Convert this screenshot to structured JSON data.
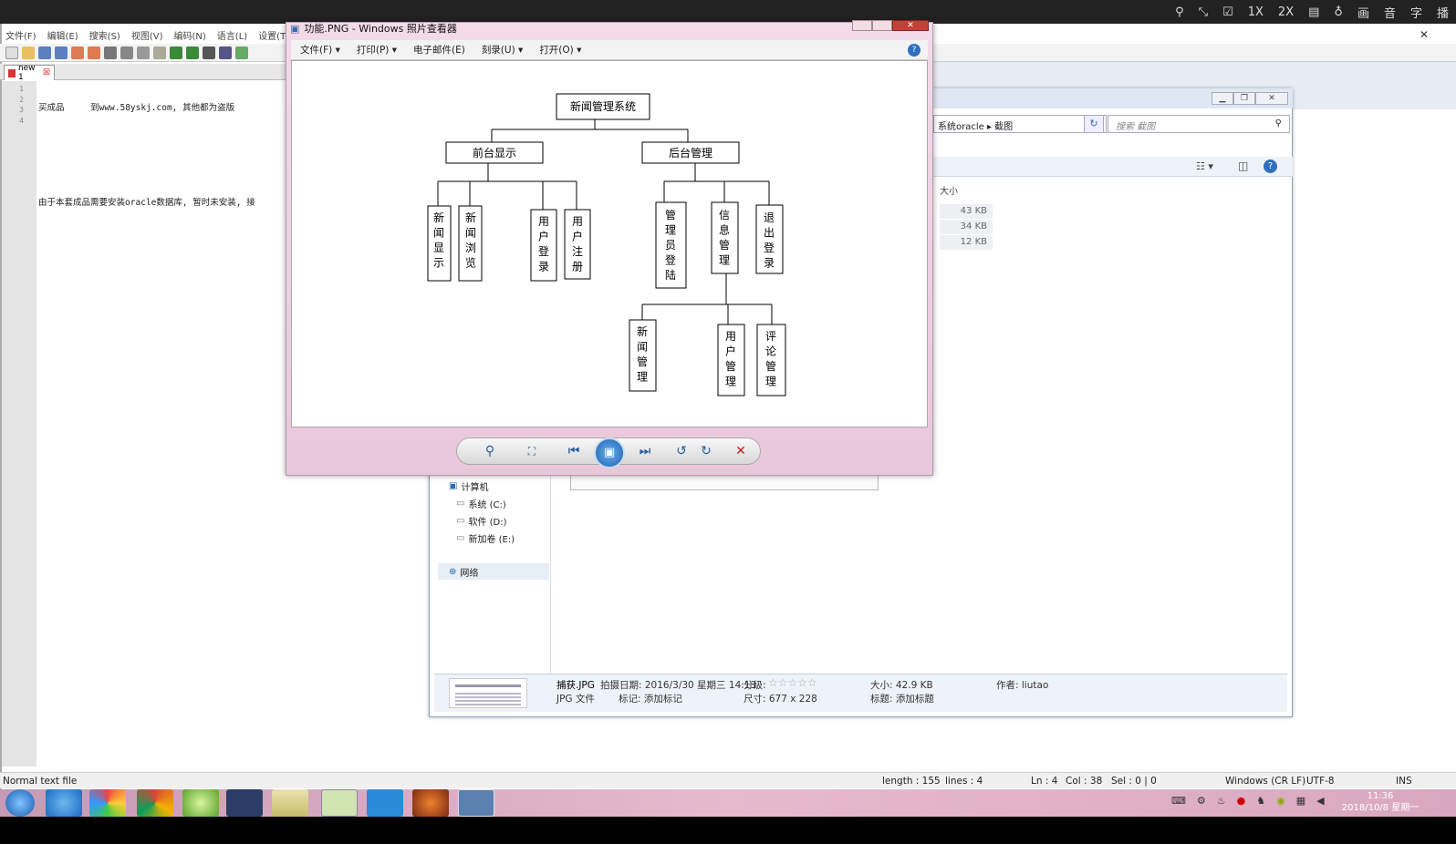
{
  "topbar": {
    "icons": [
      "1X",
      "2X",
      "画",
      "音",
      "字",
      "播"
    ]
  },
  "notepad": {
    "menu": [
      "文件(F)",
      "编辑(E)",
      "搜索(S)",
      "视图(V)",
      "编码(N)",
      "语言(L)",
      "设置(T)"
    ],
    "tab": "new 1",
    "lines": [
      "1",
      "2",
      "3",
      "4"
    ],
    "code_line1": "买成品     到www.58yskj.com, 其他都为盗版",
    "code_line4": "由于本套成品需要安装oracle数据库, 暂时未安装, 接",
    "status": {
      "type": "Normal text file",
      "length": "length : 155",
      "lines": "lines : 4",
      "ln": "Ln : 4",
      "col": "Col : 38",
      "sel": "Sel : 0 | 0",
      "eol": "Windows (CR LF)",
      "enc": "UTF-8",
      "ins": "INS"
    }
  },
  "explorer": {
    "address": "系统oracle  ▸  截图",
    "search_placeholder": "搜索 截图",
    "size_header": "大小",
    "sizes": [
      "43 KB",
      "34 KB",
      "12 KB"
    ],
    "nav": {
      "computer": "计算机",
      "drive_c": "系统 (C:)",
      "drive_d": "软件 (D:)",
      "drive_e": "新加卷 (E:)",
      "network": "网络"
    },
    "details": {
      "filename": "捕获.JPG",
      "filetype": "JPG 文件",
      "date": "拍摄日期: 2016/3/30 星期三 14:13",
      "rating": "分级:",
      "tags": "标记: 添加标记",
      "dims": "尺寸: 677 x 228",
      "size": "大小: 42.9 KB",
      "title": "标题: 添加标题",
      "author": "作者: liutao"
    }
  },
  "viewer": {
    "title": "功能.PNG - Windows 照片查看器",
    "menu": [
      "文件(F) ▾",
      "打印(P) ▾",
      "电子邮件(E)",
      "刻录(U) ▾",
      "打开(O) ▾"
    ],
    "diagram": {
      "root": "新闻管理系统",
      "front": "前台显示",
      "back": "后台管理",
      "front_items": [
        "新闻显示",
        "新闻浏览",
        "用户登录",
        "用户注册"
      ],
      "back_items": [
        "管理员登陆",
        "信息管理",
        "退出登录"
      ],
      "info_items": [
        "新闻管理",
        "用户管理",
        "评论管理"
      ]
    }
  },
  "clock": {
    "time": "11:36",
    "date": "2018/10/8 星期一"
  }
}
